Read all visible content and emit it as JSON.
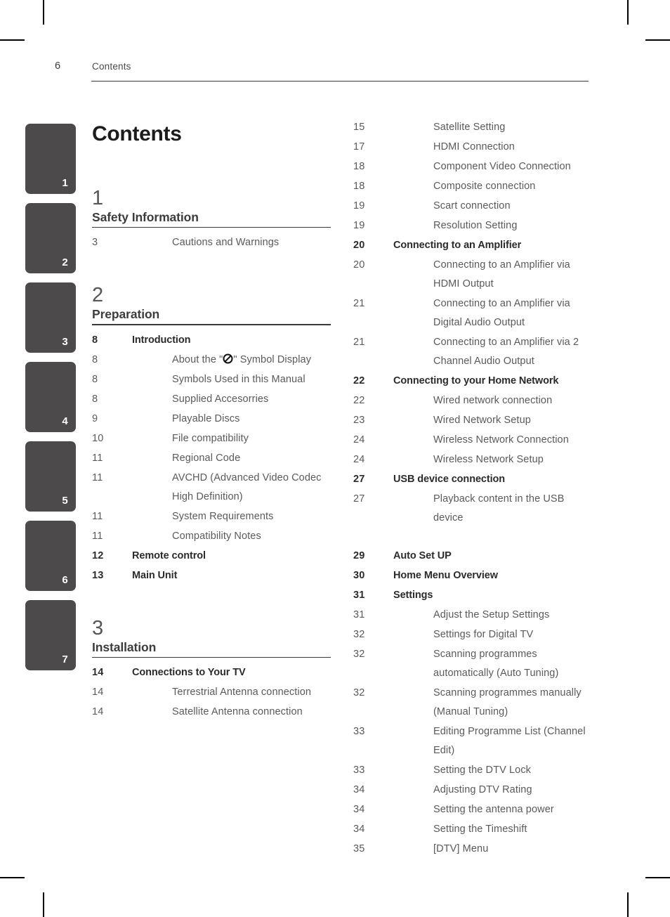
{
  "header": {
    "folio": "6",
    "chapter": "Contents"
  },
  "side_tabs": [
    "1",
    "2",
    "3",
    "4",
    "5",
    "6",
    "7"
  ],
  "doc_title": "Contents",
  "left_column": {
    "sections": [
      {
        "number": "1",
        "title": "Safety Information",
        "rows": [
          {
            "page": "3",
            "label": "Cautions and Warnings",
            "level": 2
          }
        ]
      },
      {
        "number": "2",
        "title": "Preparation",
        "rows": [
          {
            "page": "8",
            "label": "Introduction",
            "level": 1
          },
          {
            "page": "8",
            "label_pre": "About the \"",
            "glyph": "prohibition-symbol",
            "label_post": "\" Symbol Display",
            "level": 2
          },
          {
            "page": "8",
            "label": "Symbols Used in this Manual",
            "level": 2
          },
          {
            "page": "8",
            "label": "Supplied Accesorries",
            "level": 2
          },
          {
            "page": "9",
            "label": "Playable Discs",
            "level": 2
          },
          {
            "page": "10",
            "label": "File compatibility",
            "level": 2
          },
          {
            "page": "11",
            "label": "Regional Code",
            "level": 2
          },
          {
            "page": "11",
            "label": "AVCHD (Advanced Video Codec High Definition)",
            "level": 2
          },
          {
            "page": "11",
            "label": "System Requirements",
            "level": 2
          },
          {
            "page": "11",
            "label": "Compatibility Notes",
            "level": 2
          },
          {
            "page": "12",
            "label": "Remote control",
            "level": 1
          },
          {
            "page": "13",
            "label": "Main Unit",
            "level": 1
          }
        ]
      },
      {
        "number": "3",
        "title": "Installation",
        "rows": [
          {
            "page": "14",
            "label": "Connections to Your TV",
            "level": 1
          },
          {
            "page": "14",
            "label": "Terrestrial Antenna connection",
            "level": 2
          },
          {
            "page": "14",
            "label": "Satellite Antenna connection",
            "level": 2
          }
        ]
      }
    ]
  },
  "right_column": {
    "rows": [
      {
        "page": "15",
        "label": "Satellite Setting",
        "level": 2
      },
      {
        "page": "17",
        "label": "HDMI Connection",
        "level": 2
      },
      {
        "page": "18",
        "label": "Component Video Connection",
        "level": 2
      },
      {
        "page": "18",
        "label": "Composite connection",
        "level": 2
      },
      {
        "page": "19",
        "label": "Scart connection",
        "level": 2
      },
      {
        "page": "19",
        "label": "Resolution Setting",
        "level": 2
      },
      {
        "page": "20",
        "label": "Connecting to an Amplifier",
        "level": 1
      },
      {
        "page": "20",
        "label": "Connecting to an Amplifier via HDMI Output",
        "level": 2
      },
      {
        "page": "21",
        "label": "Connecting to an Amplifier via Digital Audio Output",
        "level": 2
      },
      {
        "page": "21",
        "label": "Connecting to an Amplifier via 2 Channel Audio Output",
        "level": 2
      },
      {
        "page": "22",
        "label": "Connecting to your Home Network",
        "level": 1
      },
      {
        "page": "22",
        "label": "Wired network connection",
        "level": 2
      },
      {
        "page": "23",
        "label": "Wired Network Setup",
        "level": 2
      },
      {
        "page": "24",
        "label": "Wireless Network Connection",
        "level": 2
      },
      {
        "page": "24",
        "label": "Wireless Network Setup",
        "level": 2
      },
      {
        "page": "27",
        "label": "USB device connection",
        "level": 1
      },
      {
        "page": "27",
        "label": "Playback content in the USB device",
        "level": 2
      },
      {
        "page": "29",
        "label": "Auto Set UP",
        "level": 1,
        "gap_before": true
      },
      {
        "page": "30",
        "label": "Home Menu Overview",
        "level": 1
      },
      {
        "page": "31",
        "label": "Settings",
        "level": 1
      },
      {
        "page": "31",
        "label": "Adjust the Setup Settings",
        "level": 2
      },
      {
        "page": "32",
        "label": "Settings for Digital TV",
        "level": 2
      },
      {
        "page": "32",
        "label": "Scanning programmes automatically (Auto Tuning)",
        "level": 2
      },
      {
        "page": "32",
        "label": "Scanning programmes manually (Manual Tuning)",
        "level": 2
      },
      {
        "page": "33",
        "label": "Editing Programme List (Channel Edit)",
        "level": 2
      },
      {
        "page": "33",
        "label": "Setting the DTV Lock",
        "level": 2
      },
      {
        "page": "34",
        "label": "Adjusting DTV Rating",
        "level": 2
      },
      {
        "page": "34",
        "label": "Setting the antenna power",
        "level": 2
      },
      {
        "page": "34",
        "label": "Setting the Timeshift",
        "level": 2
      },
      {
        "page": "35",
        "label": "[DTV] Menu",
        "level": 2
      }
    ]
  },
  "colors": {
    "tab_background": "#4c4a4a",
    "tab_text": "#ffffff",
    "heading_text": "#3c3c3c",
    "body_text": "#5a5a5a",
    "bold_text": "#2b2b2b",
    "rule": "#3a3a3a"
  }
}
